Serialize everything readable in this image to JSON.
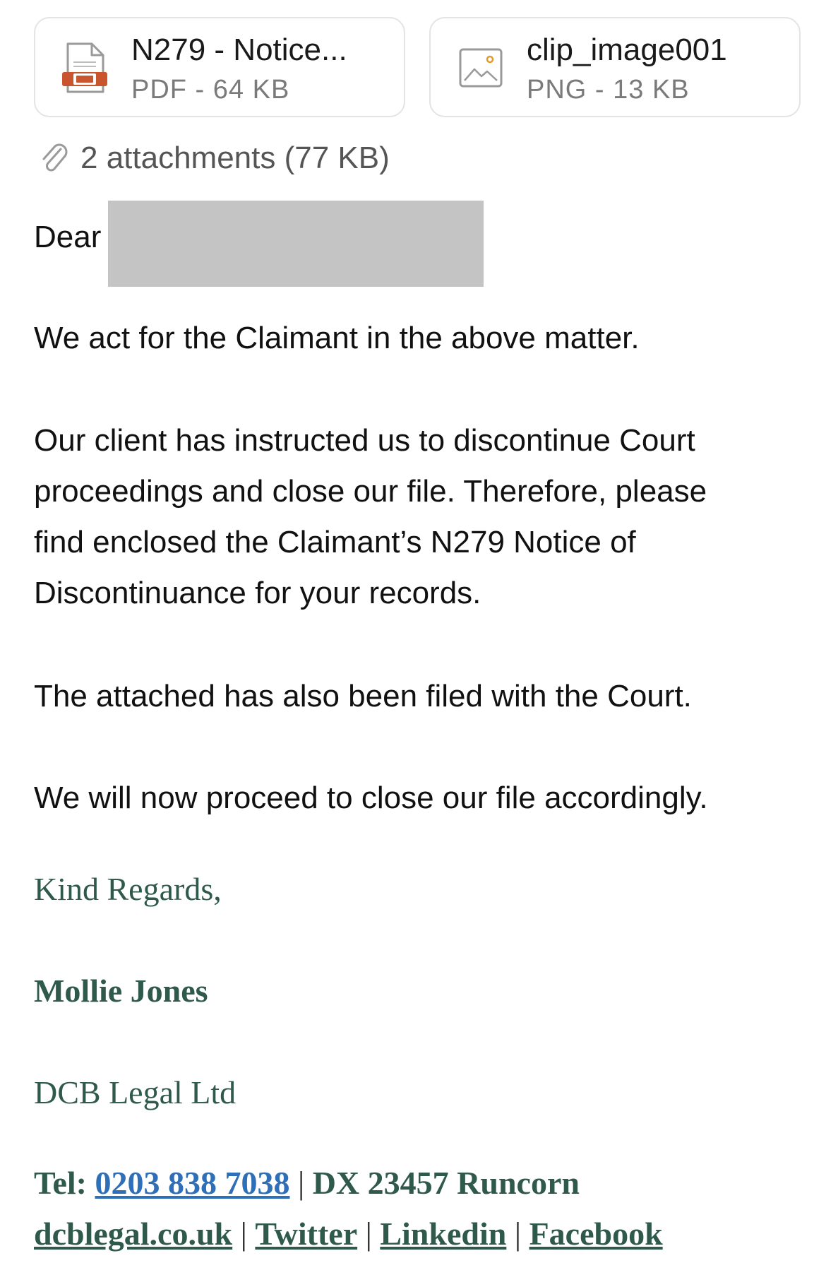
{
  "attachments": [
    {
      "name": "N279 - Notice...",
      "meta": "PDF - 64 KB",
      "icon": "pdf-file-icon"
    },
    {
      "name": "clip_image001",
      "meta": "PNG - 13 KB",
      "icon": "image-file-icon"
    }
  ],
  "summary": {
    "text": "2 attachments (77 KB)",
    "icon": "paperclip-icon"
  },
  "email": {
    "greeting": "Dear",
    "p1": "We act for the Claimant in the above matter.",
    "p2_line1": "Our client has instructed us to discontinue Court",
    "p2_line2": "proceedings and close our file. Therefore, please",
    "p2_line3": "find enclosed the Claimant’s N279 Notice of",
    "p2_line4": "Discontinuance for your records.",
    "p3": "The attached has also been filed with the Court.",
    "p4": "We will now proceed to close our file accordingly."
  },
  "signature": {
    "regards": "Kind Regards,",
    "name": "Mollie Jones",
    "firm": "DCB Legal Ltd",
    "tel_label": "Tel: ",
    "tel": "0203 838 7038",
    "sep": " | ",
    "dx": "DX 23457 Runcorn",
    "website": "dcblegal.co.uk",
    "twitter": "Twitter",
    "linkedin": "Linkedin",
    "facebook": "Facebook"
  },
  "colors": {
    "signature": "#2f5a4b",
    "phone_link": "#2f6fb8",
    "pdf_accent": "#c8552d",
    "redaction": "#c4c4c4"
  }
}
